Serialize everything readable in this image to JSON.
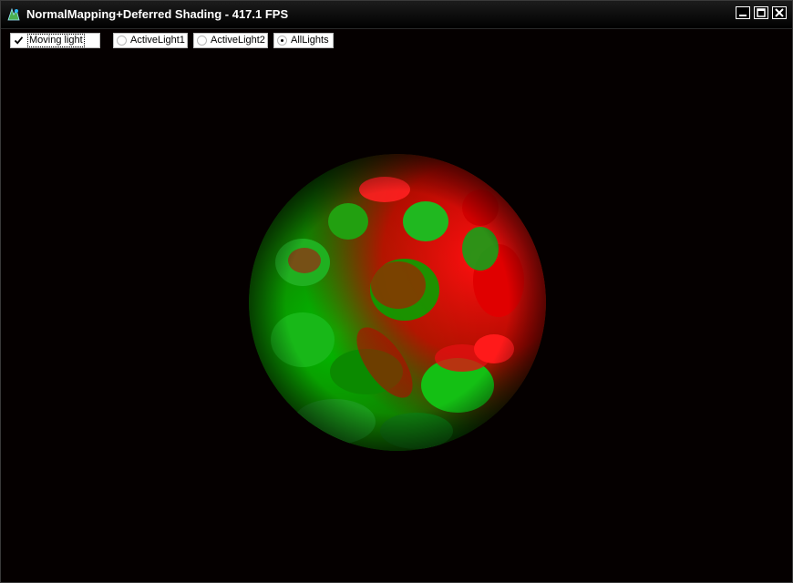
{
  "window": {
    "title": "NormalMapping+Deferred Shading - 417.1 FPS",
    "app_icon": "app-logo-icon",
    "buttons": {
      "minimize": "minimize-icon",
      "maximize": "maximize-icon",
      "close": "close-icon"
    }
  },
  "controls": {
    "moving_light": {
      "label": "Moving light",
      "checked": true
    },
    "lights": [
      {
        "label": "ActiveLight1",
        "selected": false
      },
      {
        "label": "ActiveLight2",
        "selected": false
      },
      {
        "label": "AllLights",
        "selected": true
      }
    ]
  },
  "scene": {
    "object": "sphere",
    "colors": {
      "background": "#050000",
      "light_a": "#ff0000",
      "light_b": "#00cc00"
    }
  }
}
